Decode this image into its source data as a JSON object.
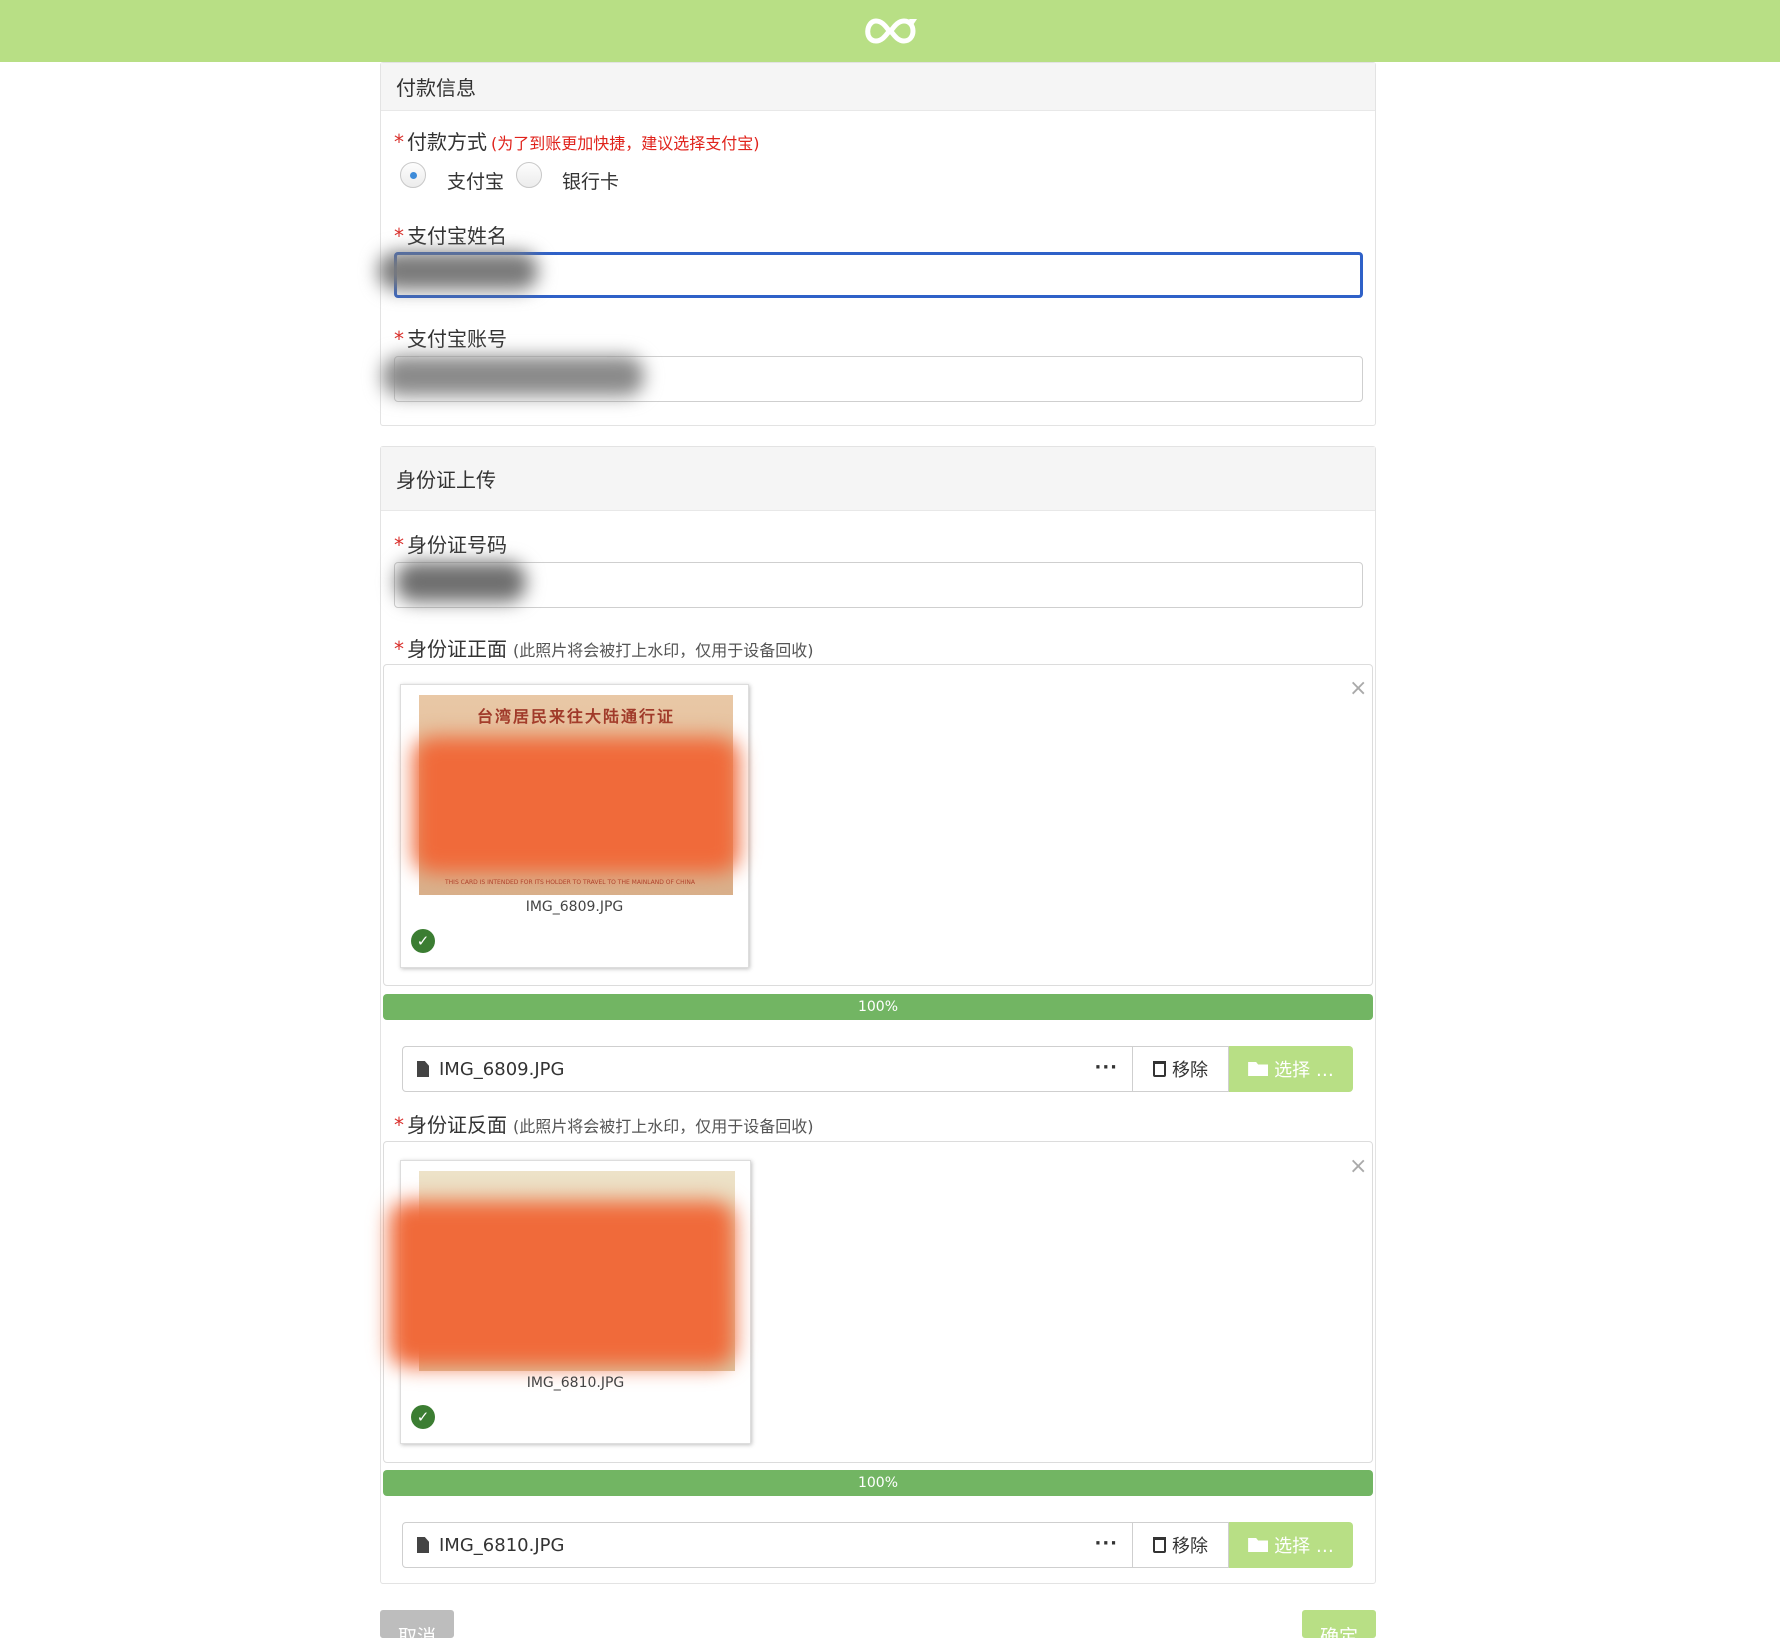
{
  "header": {
    "logo": "infinity-logo"
  },
  "payment": {
    "title": "付款信息",
    "method_label": "付款方式",
    "method_hint": "(为了到账更加快捷，建议选择支付宝)",
    "option_alipay": "支付宝",
    "option_bank": "银行卡",
    "selected": "支付宝",
    "alipay_name_label": "支付宝姓名",
    "alipay_account_label": "支付宝账号"
  },
  "identity": {
    "title": "身份证上传",
    "id_number_label": "身份证号码",
    "front": {
      "label": "身份证正面",
      "hint": "(此照片将会被打上水印，仅用于设备回收)",
      "card_title": "台湾居民来往大陆通行证",
      "card_footer": "THIS CARD IS INTENDED FOR ITS HOLDER TO TRAVEL TO THE MAINLAND OF CHINA",
      "file_name": "IMG_6809.JPG",
      "progress": "100%"
    },
    "back": {
      "label": "身份证反面",
      "hint": "(此照片将会被打上水印，仅用于设备回收)",
      "file_name": "IMG_6810.JPG",
      "progress": "100%"
    },
    "remove_label": "移除",
    "select_label": "选择 …",
    "dots": "···",
    "close": "×"
  },
  "footer": {
    "cancel": "取消",
    "confirm": "确定"
  },
  "colors": {
    "accent": "#b8df85",
    "progress": "#72b563",
    "required": "#d9302c",
    "focus": "#2f61c8"
  }
}
